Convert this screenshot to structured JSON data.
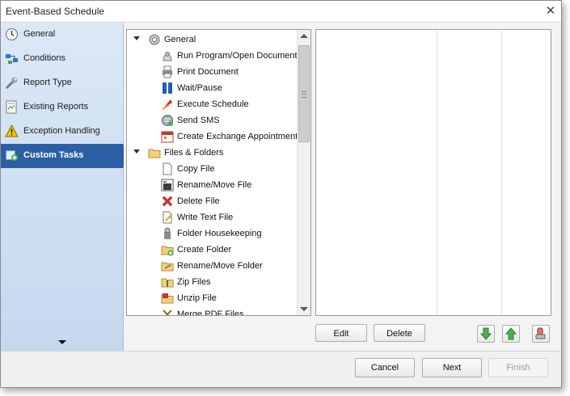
{
  "window": {
    "title": "Event-Based Schedule"
  },
  "sidebar": {
    "items": [
      {
        "label": "General",
        "icon": "clock-icon",
        "active": false
      },
      {
        "label": "Conditions",
        "icon": "conditions-icon",
        "active": false
      },
      {
        "label": "Report Type",
        "icon": "wrench-icon",
        "active": false
      },
      {
        "label": "Existing Reports",
        "icon": "report-icon",
        "active": false
      },
      {
        "label": "Exception Handling",
        "icon": "warning-icon",
        "active": false
      },
      {
        "label": "Custom Tasks",
        "icon": "custom-tasks-icon",
        "active": true
      }
    ]
  },
  "tree": {
    "groups": [
      {
        "label": "General",
        "icon": "gear-icon",
        "children": [
          {
            "label": "Run Program/Open Document",
            "icon": "program-icon"
          },
          {
            "label": "Print Document",
            "icon": "printer-icon"
          },
          {
            "label": "Wait/Pause",
            "icon": "pause-icon"
          },
          {
            "label": "Execute Schedule",
            "icon": "execute-icon"
          },
          {
            "label": "Send SMS",
            "icon": "sms-icon"
          },
          {
            "label": "Create Exchange Appointment",
            "icon": "appointment-icon"
          }
        ]
      },
      {
        "label": "Files & Folders",
        "icon": "folder-icon",
        "children": [
          {
            "label": "Copy File",
            "icon": "copy-file-icon"
          },
          {
            "label": "Rename/Move File",
            "icon": "rename-file-icon"
          },
          {
            "label": "Delete File",
            "icon": "delete-x-icon"
          },
          {
            "label": "Write Text File",
            "icon": "write-file-icon"
          },
          {
            "label": "Folder Housekeeping",
            "icon": "housekeeping-icon"
          },
          {
            "label": "Create Folder",
            "icon": "create-folder-icon"
          },
          {
            "label": "Rename/Move Folder",
            "icon": "rename-folder-icon"
          },
          {
            "label": "Zip Files",
            "icon": "zip-icon"
          },
          {
            "label": "Unzip File",
            "icon": "unzip-icon"
          },
          {
            "label": "Merge PDF Files",
            "icon": "merge-pdf-icon"
          }
        ]
      }
    ]
  },
  "actions": {
    "edit": "Edit",
    "delete": "Delete",
    "move_down": "arrow-down-icon",
    "move_up": "arrow-up-icon",
    "clear": "eraser-icon"
  },
  "footer": {
    "cancel": "Cancel",
    "next": "Next",
    "finish": "Finish"
  },
  "colors": {
    "active_nav": "#2c5ea3",
    "sidebar_top": "#dbe8f6",
    "sidebar_bottom": "#c5d8ee"
  }
}
